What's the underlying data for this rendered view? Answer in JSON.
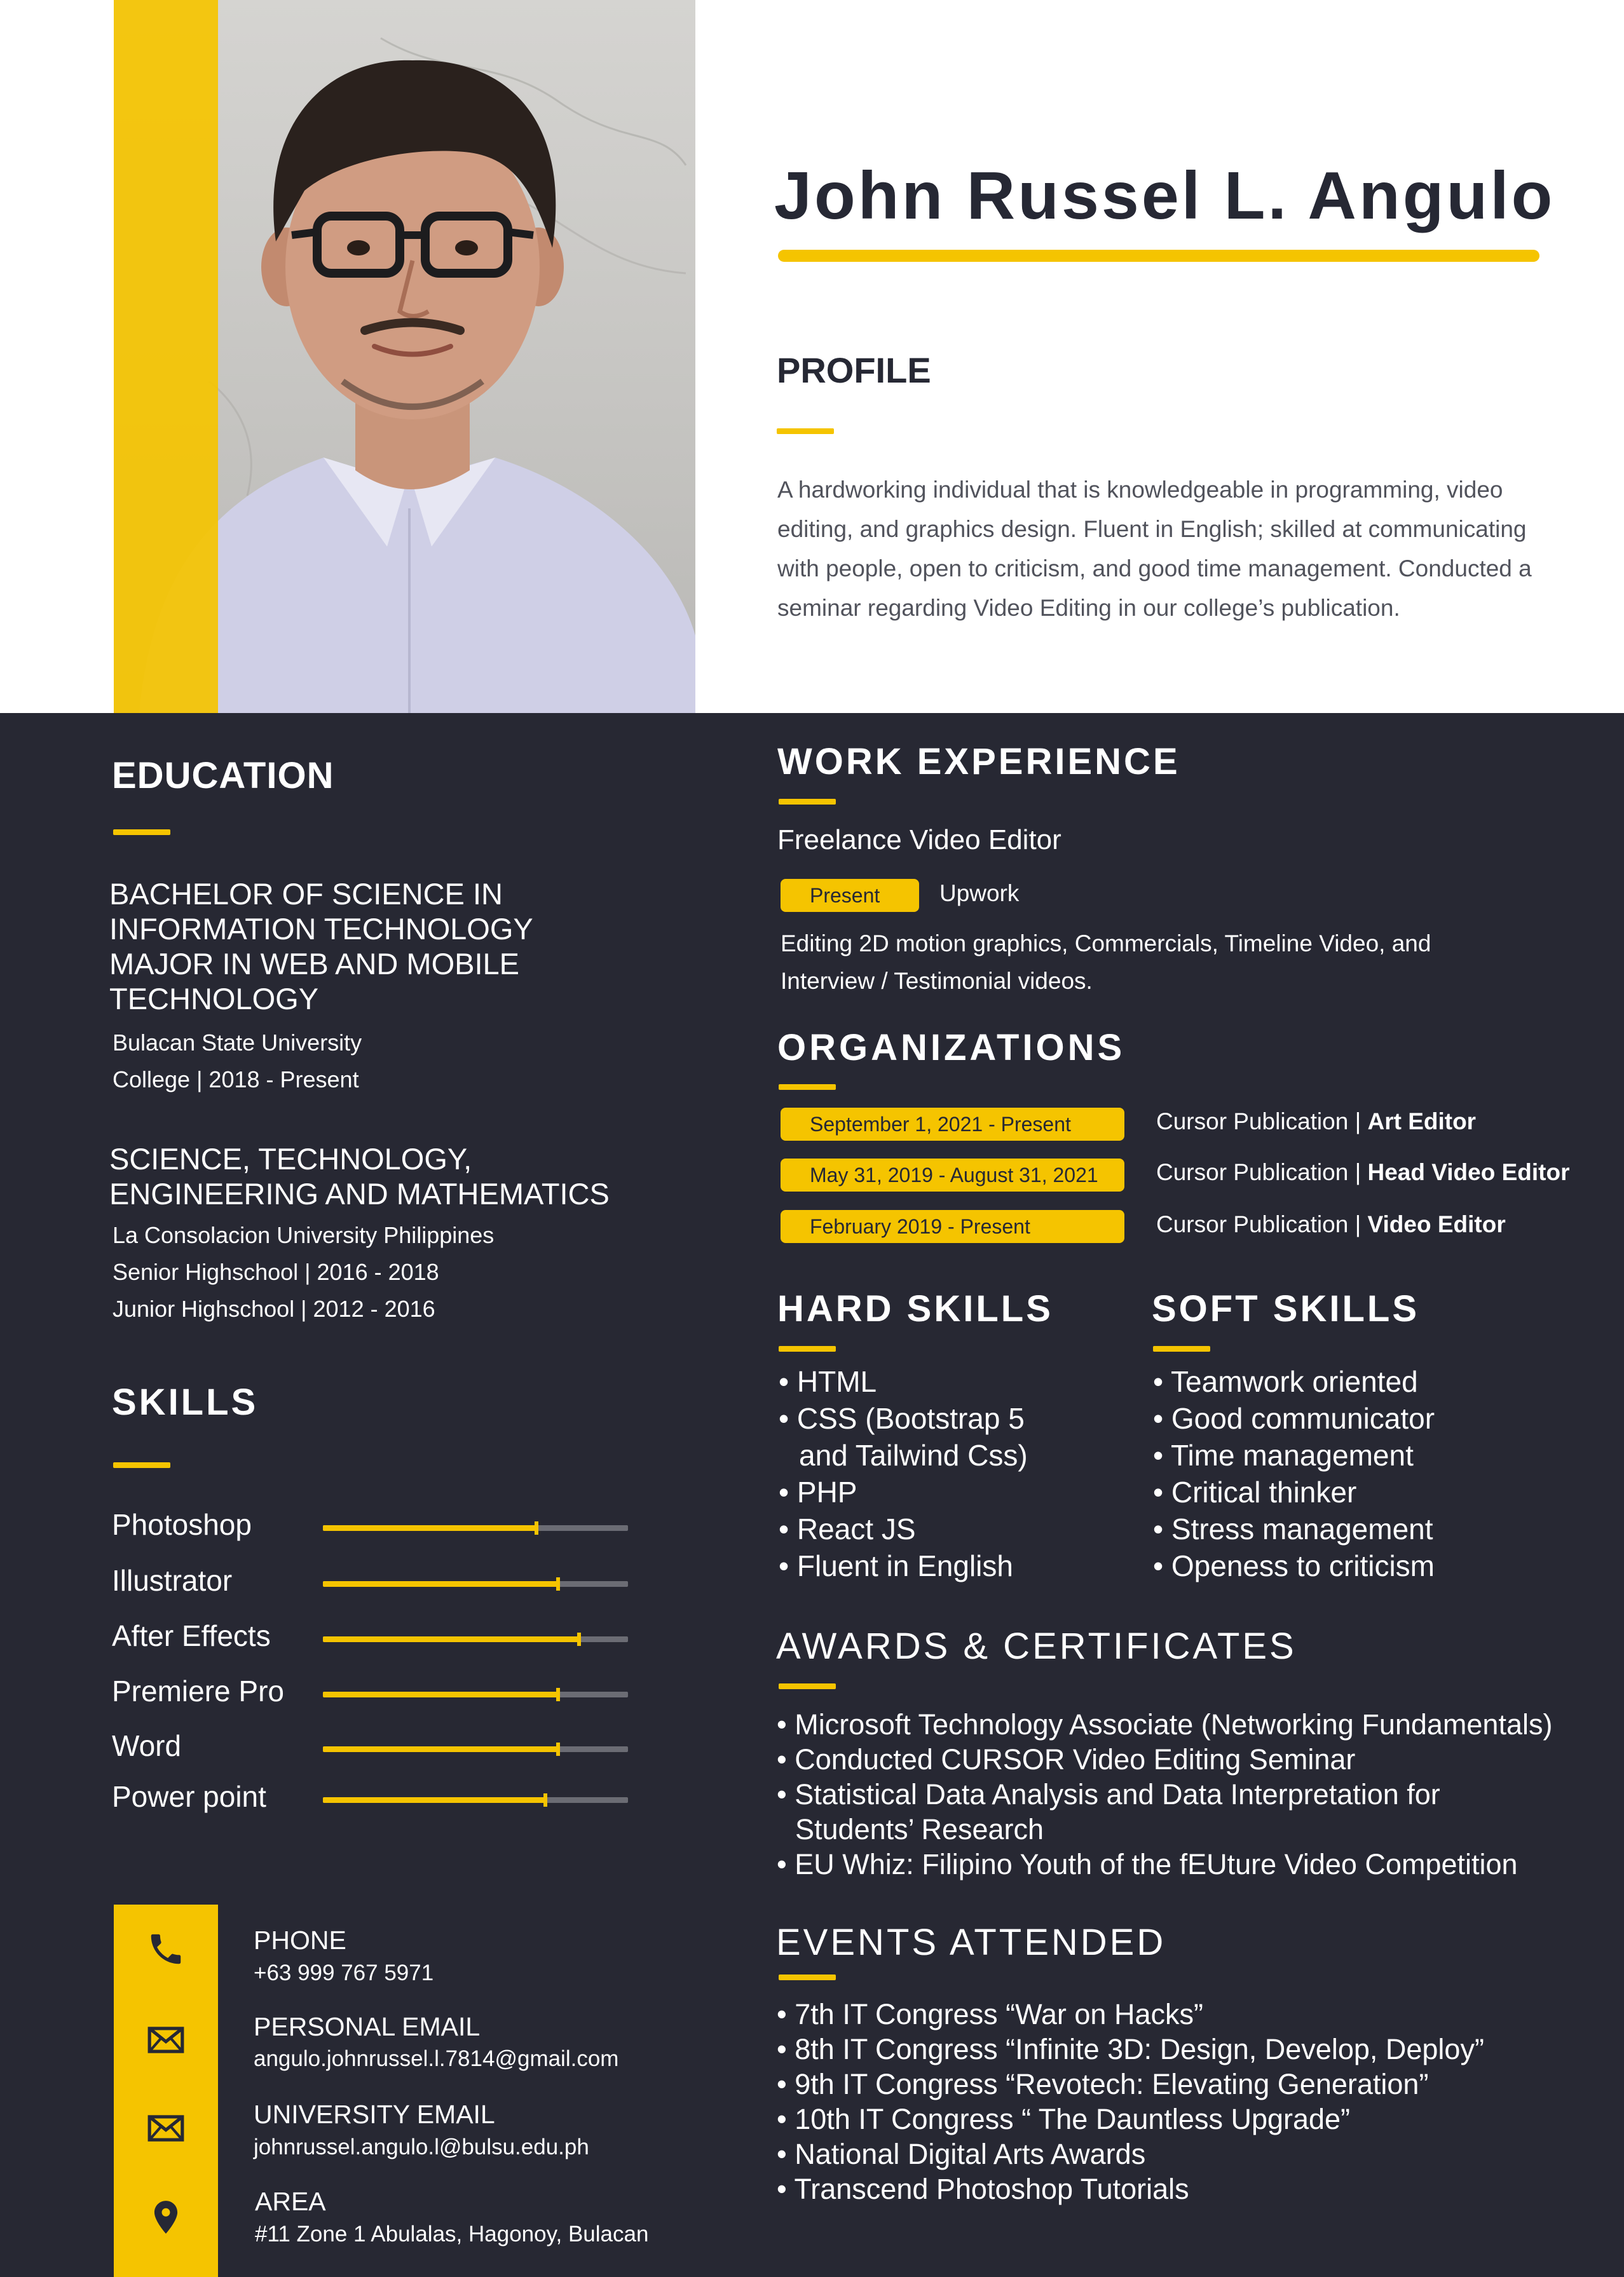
{
  "header": {
    "name": "John Russel L. Angulo"
  },
  "profile": {
    "heading": "PROFILE",
    "text": "A hardworking individual that is knowledgeable in programming, video editing, and graphics design. Fluent in English; skilled at communicating with people, open to criticism, and good time management. Conducted a seminar regarding Video Editing in our college’s publication."
  },
  "education": {
    "heading": "EDUCATION",
    "entries": [
      {
        "degree": "BACHELOR OF SCIENCE IN INFORMATION TECHNOLOGY MAJOR IN WEB AND MOBILE TECHNOLOGY",
        "lines": [
          "Bulacan State University",
          "College | 2018 - Present"
        ]
      },
      {
        "degree": "SCIENCE, TECHNOLOGY, ENGINEERING AND MATHEMATICS",
        "lines": [
          "La Consolacion University Philippines",
          "Senior Highschool | 2016 - 2018",
          "Junior Highschool | 2012 - 2016"
        ]
      }
    ]
  },
  "skills": {
    "heading": "SKILLS",
    "items": [
      {
        "name": "Photoshop",
        "level": 0.7
      },
      {
        "name": "Illustrator",
        "level": 0.77
      },
      {
        "name": "After Effects",
        "level": 0.84
      },
      {
        "name": "Premiere Pro",
        "level": 0.77
      },
      {
        "name": "Word",
        "level": 0.77
      },
      {
        "name": "Power point",
        "level": 0.73
      }
    ]
  },
  "contact": {
    "phone_label": "PHONE",
    "phone_value": "+63 999 767 5971",
    "personal_email_label": "PERSONAL EMAIL",
    "personal_email_value": "angulo.johnrussel.l.7814@gmail.com",
    "university_email_label": "UNIVERSITY EMAIL",
    "university_email_value": "johnrussel.angulo.l@bulsu.edu.ph",
    "area_label": "AREA",
    "area_value": "#11 Zone 1 Abulalas, Hagonoy, Bulacan",
    "icons": [
      "phone-icon",
      "mail-icon",
      "mail-icon",
      "location-pin-icon"
    ]
  },
  "work": {
    "heading": "WORK EXPERIENCE",
    "title": "Freelance Video Editor",
    "status": "Present",
    "company": "Upwork",
    "description": "Editing 2D motion graphics, Commercials, Timeline Video, and Interview / Testimonial videos."
  },
  "organizations": {
    "heading": "ORGANIZATIONS",
    "entries": [
      {
        "dates": "September 1, 2021 - Present",
        "org": "Cursor Publication | ",
        "role": "Art Editor"
      },
      {
        "dates": "May 31, 2019 - August 31, 2021",
        "org": "Cursor Publication | ",
        "role": "Head Video Editor"
      },
      {
        "dates": "February 2019 - Present",
        "org": "Cursor Publication | ",
        "role": "Video Editor"
      }
    ]
  },
  "hard_skills": {
    "heading": "HARD SKILLS",
    "items": [
      "• HTML",
      "• CSS (Bootstrap 5",
      "and Tailwind Css)",
      "• PHP",
      "• React JS",
      "• Fluent in English"
    ]
  },
  "soft_skills": {
    "heading": "SOFT SKILLS",
    "items": [
      "• Teamwork oriented",
      "• Good communicator",
      "• Time management",
      "• Critical thinker",
      "• Stress management",
      "• Openess to criticism"
    ]
  },
  "awards": {
    "heading": "AWARDS & CERTIFICATES",
    "items": [
      "• Microsoft Technology Associate (Networking Fundamentals)",
      "• Conducted CURSOR Video Editing Seminar",
      "• Statistical Data Analysis and Data Interpretation for",
      "Students’ Research",
      "• EU Whiz: Filipino Youth of the fEUture Video Competition"
    ]
  },
  "events": {
    "heading": "EVENTS ATTENDED",
    "items": [
      "• 7th IT Congress “War on Hacks”",
      "• 8th IT Congress “Infinite 3D: Design, Develop, Deploy”",
      "• 9th IT Congress “Revotech: Elevating Generation”",
      "• 10th IT Congress “ The Dauntless Upgrade”",
      "• National Digital Arts Awards",
      "• Transcend Photoshop Tutorials"
    ]
  },
  "colors": {
    "accent": "#f5c400",
    "dark": "#272833",
    "text_dark": "#262834"
  }
}
